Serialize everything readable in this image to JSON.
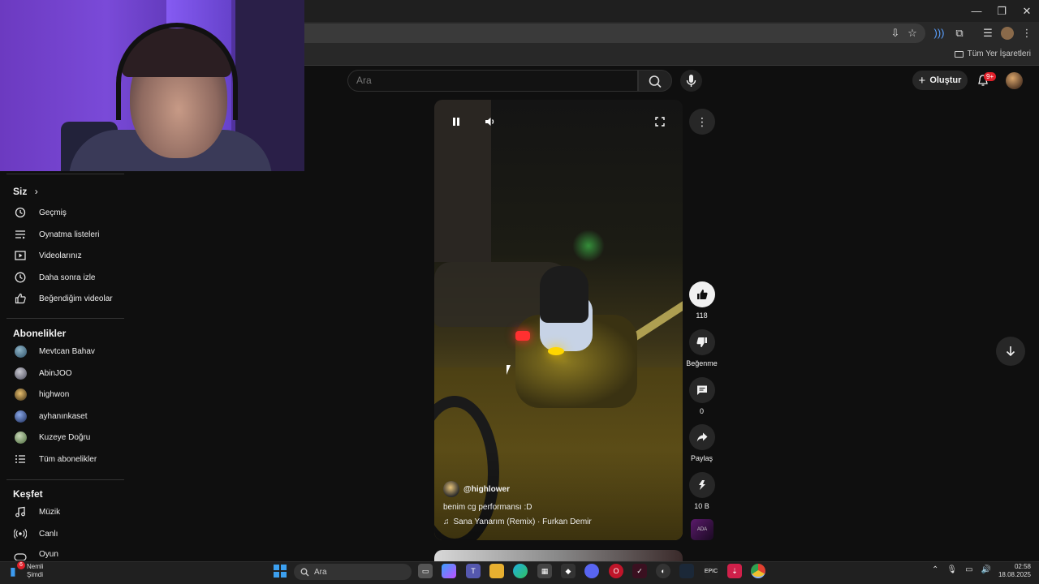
{
  "browser": {
    "bookmarks_all": "Tüm Yer İşaretleri"
  },
  "youtube": {
    "search_placeholder": "Ara",
    "create_label": "Oluştur",
    "notif_count": "9+"
  },
  "sidebar": {
    "you_heading": "Siz",
    "you_items": [
      {
        "label": "Geçmiş",
        "icon": "history-icon"
      },
      {
        "label": "Oynatma listeleri",
        "icon": "playlist-icon"
      },
      {
        "label": "Videolarınız",
        "icon": "your-videos-icon"
      },
      {
        "label": "Daha sonra izle",
        "icon": "watch-later-icon"
      },
      {
        "label": "Beğendiğim videolar",
        "icon": "liked-icon"
      }
    ],
    "subs_heading": "Abonelikler",
    "subscriptions": [
      {
        "label": "Mevtcan Bahav",
        "color": "#3a6a8a"
      },
      {
        "label": "AbinJOO",
        "color": "#8a8a9a"
      },
      {
        "label": "highwon",
        "color": "#c8a040"
      },
      {
        "label": "ayhanınkaset",
        "color": "#3a5aa8"
      },
      {
        "label": "Kuzeye Doğru",
        "color": "#7a9a6a"
      }
    ],
    "all_subs": "Tüm abonelikler",
    "explore_heading": "Keşfet",
    "explore_items": [
      {
        "label": "Müzik",
        "icon": "music-icon"
      },
      {
        "label": "Canlı",
        "icon": "live-icon"
      },
      {
        "label": "Oyun",
        "icon": "gaming-icon"
      }
    ]
  },
  "short": {
    "author": "@highlower",
    "description": "benim cg performansı :D",
    "music": "Sana Yanarım (Remix) · Furkan Demir",
    "likes": "118",
    "dislike_label": "Beğenme",
    "comments": "0",
    "share_label": "Paylaş",
    "remix_count": "10 B",
    "sound_thumb_text": "ADA"
  },
  "taskbar": {
    "notif_title": "Nemli",
    "notif_time": "Şimdi",
    "notif_badge": "6",
    "search_label": "Ara",
    "time": "02:58",
    "date": "18.08.2025"
  },
  "colors": {
    "accent_blue": "#3ca0f0",
    "badge_red": "#e0202a"
  }
}
